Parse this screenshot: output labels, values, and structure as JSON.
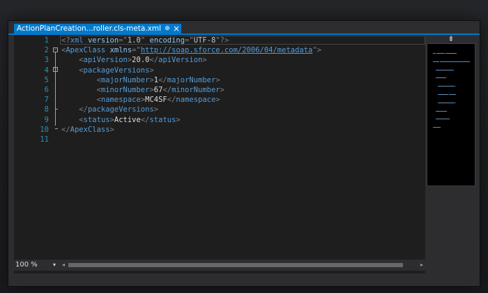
{
  "tab": {
    "title": "ActionPlanCreation...roller.cls-meta.xml",
    "pin_glyph": "⊕",
    "close_glyph": "×"
  },
  "editor": {
    "line_numbers": [
      "1",
      "2",
      "3",
      "4",
      "5",
      "6",
      "7",
      "8",
      "9",
      "10",
      "11"
    ],
    "lines": [
      [
        {
          "c": "b",
          "t": "<?"
        },
        {
          "c": "t",
          "t": "xml"
        },
        {
          "c": "x",
          "t": " "
        },
        {
          "c": "a",
          "t": "version"
        },
        {
          "c": "b",
          "t": "="
        },
        {
          "c": "b",
          "t": "\""
        },
        {
          "c": "v",
          "t": "1.0"
        },
        {
          "c": "b",
          "t": "\""
        },
        {
          "c": "x",
          "t": " "
        },
        {
          "c": "a",
          "t": "encoding"
        },
        {
          "c": "b",
          "t": "="
        },
        {
          "c": "b",
          "t": "\""
        },
        {
          "c": "v",
          "t": "UTF-8"
        },
        {
          "c": "b",
          "t": "\""
        },
        {
          "c": "b",
          "t": "?>"
        }
      ],
      [
        {
          "c": "b",
          "t": "<"
        },
        {
          "c": "t",
          "t": "ApexClass"
        },
        {
          "c": "x",
          "t": " "
        },
        {
          "c": "a",
          "t": "xmlns"
        },
        {
          "c": "b",
          "t": "="
        },
        {
          "c": "b",
          "t": "\""
        },
        {
          "c": "u",
          "t": "http://soap.sforce.com/2006/04/metadata"
        },
        {
          "c": "b",
          "t": "\""
        },
        {
          "c": "b",
          "t": ">"
        }
      ],
      [
        {
          "c": "x",
          "t": "    "
        },
        {
          "c": "b",
          "t": "<"
        },
        {
          "c": "t",
          "t": "apiVersion"
        },
        {
          "c": "b",
          "t": ">"
        },
        {
          "c": "x",
          "t": "20.0"
        },
        {
          "c": "b",
          "t": "</"
        },
        {
          "c": "t",
          "t": "apiVersion"
        },
        {
          "c": "b",
          "t": ">"
        }
      ],
      [
        {
          "c": "x",
          "t": "    "
        },
        {
          "c": "b",
          "t": "<"
        },
        {
          "c": "t",
          "t": "packageVersions"
        },
        {
          "c": "b",
          "t": ">"
        }
      ],
      [
        {
          "c": "x",
          "t": "        "
        },
        {
          "c": "b",
          "t": "<"
        },
        {
          "c": "t",
          "t": "majorNumber"
        },
        {
          "c": "b",
          "t": ">"
        },
        {
          "c": "x",
          "t": "1"
        },
        {
          "c": "b",
          "t": "</"
        },
        {
          "c": "t",
          "t": "majorNumber"
        },
        {
          "c": "b",
          "t": ">"
        }
      ],
      [
        {
          "c": "x",
          "t": "        "
        },
        {
          "c": "b",
          "t": "<"
        },
        {
          "c": "t",
          "t": "minorNumber"
        },
        {
          "c": "b",
          "t": ">"
        },
        {
          "c": "x",
          "t": "67"
        },
        {
          "c": "b",
          "t": "</"
        },
        {
          "c": "t",
          "t": "minorNumber"
        },
        {
          "c": "b",
          "t": ">"
        }
      ],
      [
        {
          "c": "x",
          "t": "        "
        },
        {
          "c": "b",
          "t": "<"
        },
        {
          "c": "t",
          "t": "namespace"
        },
        {
          "c": "b",
          "t": ">"
        },
        {
          "c": "x",
          "t": "MC4SF"
        },
        {
          "c": "b",
          "t": "</"
        },
        {
          "c": "t",
          "t": "namespace"
        },
        {
          "c": "b",
          "t": ">"
        }
      ],
      [
        {
          "c": "x",
          "t": "    "
        },
        {
          "c": "b",
          "t": "</"
        },
        {
          "c": "t",
          "t": "packageVersions"
        },
        {
          "c": "b",
          "t": ">"
        }
      ],
      [
        {
          "c": "x",
          "t": "    "
        },
        {
          "c": "b",
          "t": "<"
        },
        {
          "c": "t",
          "t": "status"
        },
        {
          "c": "b",
          "t": ">"
        },
        {
          "c": "x",
          "t": "Active"
        },
        {
          "c": "b",
          "t": "</"
        },
        {
          "c": "t",
          "t": "status"
        },
        {
          "c": "b",
          "t": ">"
        }
      ],
      [
        {
          "c": "b",
          "t": "</"
        },
        {
          "c": "t",
          "t": "ApexClass"
        },
        {
          "c": "b",
          "t": ">"
        }
      ],
      []
    ],
    "fold_minus": "−"
  },
  "minimap": {
    "split_glyph": "⇟"
  },
  "statusbar": {
    "zoom": "100 %",
    "zoom_dropdown": "▾",
    "scroll_left": "◂",
    "scroll_right": "▸"
  },
  "colors": {
    "accent": "#007acc",
    "background": "#1e1e1e",
    "tag": "#569cd6",
    "attribute": "#92caf4",
    "line_number": "#2b91af"
  }
}
